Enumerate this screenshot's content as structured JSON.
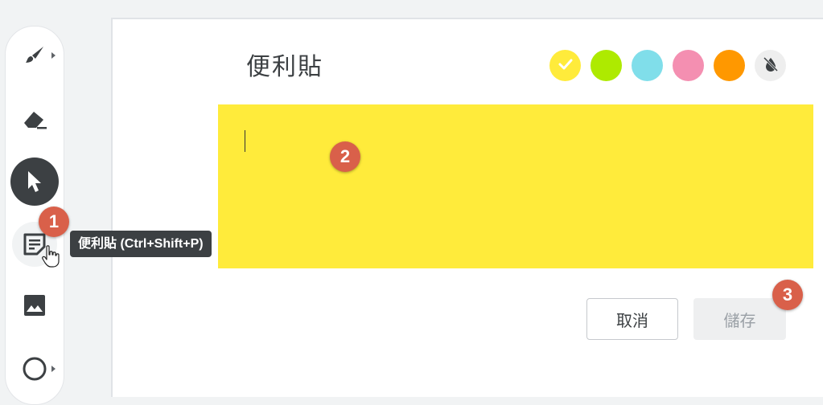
{
  "toolbar": {
    "tools": [
      {
        "name": "pen",
        "icon": "pen-icon"
      },
      {
        "name": "eraser",
        "icon": "eraser-icon"
      },
      {
        "name": "select",
        "icon": "cursor-icon"
      },
      {
        "name": "sticky-note",
        "icon": "sticky-note-icon"
      },
      {
        "name": "image",
        "icon": "image-icon"
      },
      {
        "name": "shape",
        "icon": "circle-icon"
      }
    ],
    "tooltip": "便利貼 (Ctrl+Shift+P)"
  },
  "panel": {
    "title": "便利貼",
    "colors": [
      "#ffeb3b",
      "#aeea00",
      "#80deea",
      "#f48fb1",
      "#ff9800"
    ],
    "selected_color": "#ffeb3b",
    "note_text": "",
    "cancel_label": "取消",
    "save_label": "儲存"
  },
  "markers": [
    "1",
    "2",
    "3"
  ],
  "colors": {
    "marker": "#d9604a",
    "tooltip_bg": "#3c4043",
    "select_tool_bg": "#3c4043"
  }
}
